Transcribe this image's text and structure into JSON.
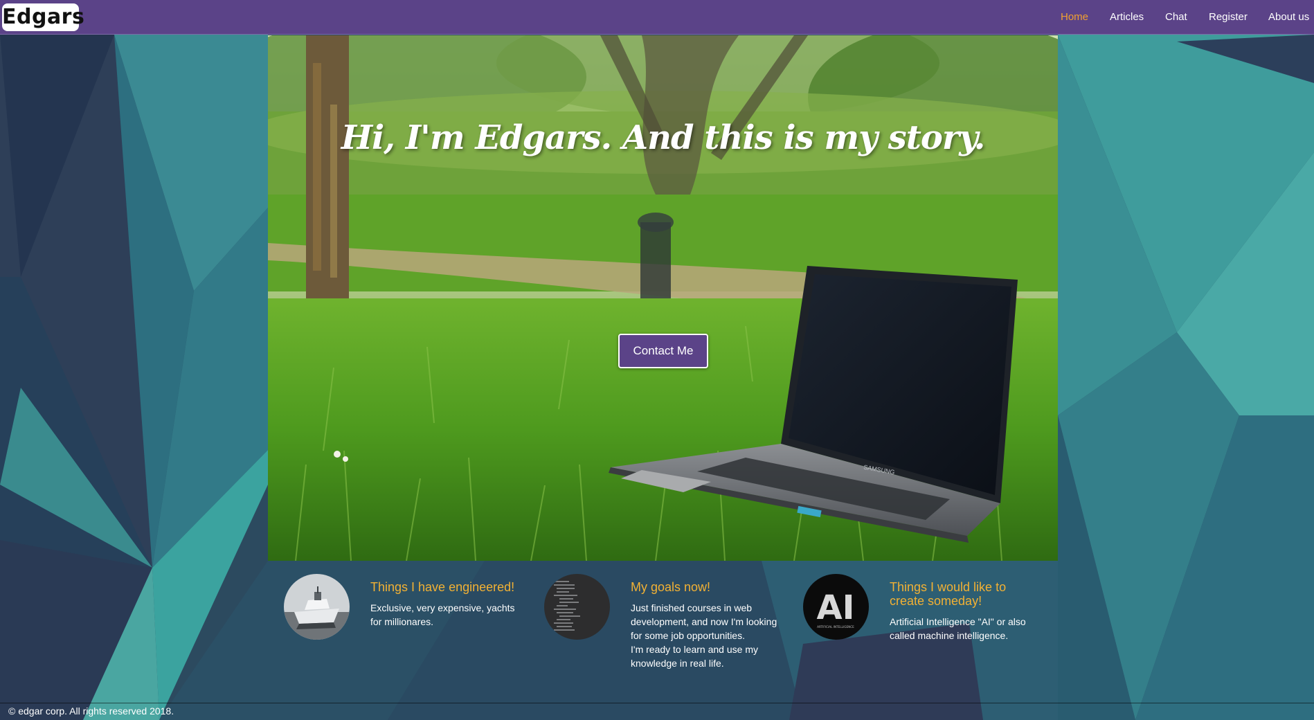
{
  "nav": {
    "logo": "Edgars",
    "links": [
      {
        "label": "Home",
        "active": true
      },
      {
        "label": "Articles",
        "active": false
      },
      {
        "label": "Chat",
        "active": false
      },
      {
        "label": "Register",
        "active": false
      },
      {
        "label": "About us",
        "active": false
      }
    ]
  },
  "hero": {
    "title": "Hi, I'm Edgars. And this is my story.",
    "cta_label": "Contact Me",
    "laptop_brand": "SAMSUNG"
  },
  "features": [
    {
      "title": "Things I have engineered!",
      "text_lines": [
        "Exclusive, very expensive, yachts",
        "for millionares."
      ],
      "icon": "yacht-icon"
    },
    {
      "title": "My goals now!",
      "text_lines": [
        "Just finished courses in web",
        "development, and now I'm looking",
        "for some job opportunities.",
        "I'm ready to learn and use my",
        "knowledge in real life."
      ],
      "icon": "code-screen-icon"
    },
    {
      "title_lines": [
        "Things I would like to",
        "create someday!"
      ],
      "text_lines": [
        "Artificial Intelligence \"AI\" or also",
        "called machine intelligence."
      ],
      "icon": "ai-icon",
      "badge_text": "AI",
      "badge_caption": "ARTIFICIAL INTELLIGENCE"
    }
  ],
  "footer": {
    "text": "© edgar corp. All rights reserved 2018."
  },
  "colors": {
    "nav_bg": "#5b4388",
    "accent": "#f0a030",
    "feature_title": "#f2b134",
    "button_bg": "#5b4388"
  }
}
